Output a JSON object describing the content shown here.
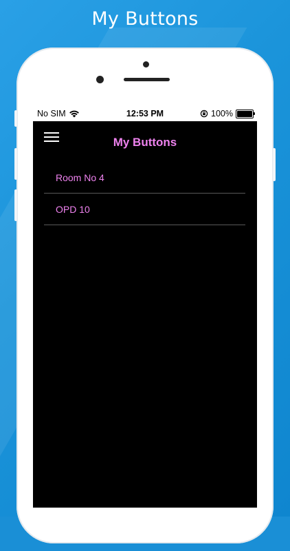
{
  "headline": "My Buttons",
  "colors": {
    "accent": "#ee82ee",
    "background": "#1a8fd6",
    "screen": "#000000",
    "divider": "#5a5a5a"
  },
  "status_bar": {
    "carrier": "No SIM",
    "wifi_icon": "wifi-icon",
    "time": "12:53 PM",
    "orientation_lock_icon": "orientation-lock-icon",
    "battery_percent": "100%",
    "battery_icon": "battery-icon"
  },
  "navbar": {
    "menu_icon": "hamburger-menu-icon",
    "title": "My Buttons"
  },
  "list": {
    "items": [
      {
        "label": "Room No 4"
      },
      {
        "label": "OPD 10"
      }
    ]
  }
}
